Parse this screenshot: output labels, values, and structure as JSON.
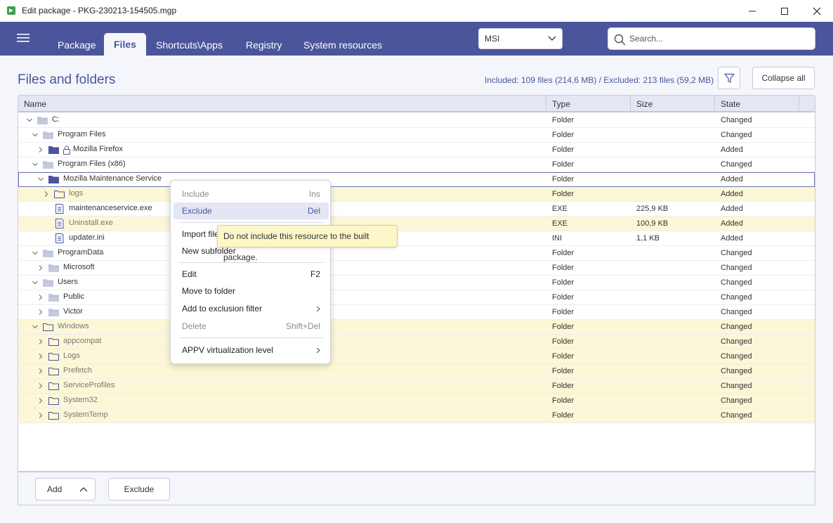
{
  "window": {
    "title": "Edit package - PKG-230213-154505.mgp"
  },
  "header": {
    "tabs": [
      {
        "label": "Package"
      },
      {
        "label": "Files"
      },
      {
        "label": "Shortcuts\\Apps"
      },
      {
        "label": "Registry"
      },
      {
        "label": "System resources"
      }
    ],
    "active_tab": "Files",
    "format_select": "MSI",
    "search_placeholder": "Search..."
  },
  "main": {
    "title": "Files and folders",
    "summary": "Included: 109 files (214,6 MB) / Excluded: 213 files (59,2 MB)",
    "collapse_label": "Collapse all"
  },
  "table": {
    "columns": [
      "Name",
      "Type",
      "Size",
      "State"
    ],
    "rows": [
      {
        "name": "C:",
        "type": "Folder",
        "size": "",
        "state": "Changed"
      },
      {
        "name": "Program Files",
        "type": "Folder",
        "size": "",
        "state": "Changed"
      },
      {
        "name": "Mozilla Firefox",
        "type": "Folder",
        "size": "",
        "state": "Added"
      },
      {
        "name": "Program Files (x86)",
        "type": "Folder",
        "size": "",
        "state": "Changed"
      },
      {
        "name": "Mozilla Maintenance Service",
        "type": "Folder",
        "size": "",
        "state": "Added"
      },
      {
        "name": "logs",
        "type": "Folder",
        "size": "",
        "state": "Added"
      },
      {
        "name": "maintenanceservice.exe",
        "type": "EXE",
        "size": "225,9 KB",
        "state": "Added"
      },
      {
        "name": "Uninstall.exe",
        "type": "EXE",
        "size": "100,9 KB",
        "state": "Added"
      },
      {
        "name": "updater.ini",
        "type": "INI",
        "size": "1,1 KB",
        "state": "Added"
      },
      {
        "name": "ProgramData",
        "type": "Folder",
        "size": "",
        "state": "Changed"
      },
      {
        "name": "Microsoft",
        "type": "Folder",
        "size": "",
        "state": "Changed"
      },
      {
        "name": "Users",
        "type": "Folder",
        "size": "",
        "state": "Changed"
      },
      {
        "name": "Public",
        "type": "Folder",
        "size": "",
        "state": "Changed"
      },
      {
        "name": "Victor",
        "type": "Folder",
        "size": "",
        "state": "Changed"
      },
      {
        "name": "Windows",
        "type": "Folder",
        "size": "",
        "state": "Changed"
      },
      {
        "name": "appcompat",
        "type": "Folder",
        "size": "",
        "state": "Changed"
      },
      {
        "name": "Logs",
        "type": "Folder",
        "size": "",
        "state": "Changed"
      },
      {
        "name": "Prefetch",
        "type": "Folder",
        "size": "",
        "state": "Changed"
      },
      {
        "name": "ServiceProfiles",
        "type": "Folder",
        "size": "",
        "state": "Changed"
      },
      {
        "name": "System32",
        "type": "Folder",
        "size": "",
        "state": "Changed"
      },
      {
        "name": "SystemTemp",
        "type": "Folder",
        "size": "",
        "state": "Changed"
      }
    ]
  },
  "footer": {
    "add_label": "Add",
    "exclude_label": "Exclude"
  },
  "context_menu": {
    "items": [
      {
        "label": "Include",
        "shortcut": "Ins"
      },
      {
        "label": "Exclude",
        "shortcut": "Del"
      },
      {
        "label": "Import files"
      },
      {
        "label": "New subfolder"
      },
      {
        "label": "Edit",
        "shortcut": "F2"
      },
      {
        "label": "Move to folder"
      },
      {
        "label": "Add to exclusion filter"
      },
      {
        "label": "Delete",
        "shortcut": "Shift+Del"
      },
      {
        "label": "APPV virtualization level"
      }
    ]
  },
  "tooltip": "Do not include this resource to the built package.",
  "icons": {
    "app": "package-icon",
    "menu": "hamburger-icon",
    "search": "search-icon",
    "filter": "funnel-icon",
    "lock": "lock-icon"
  },
  "colors": {
    "accent": "#4a559c",
    "folder_blue": "#4a559c",
    "folder_gray": "#c5c9dc",
    "highlight_yellow": "#fcf7d6",
    "tooltip_bg": "#fdf6c8"
  }
}
